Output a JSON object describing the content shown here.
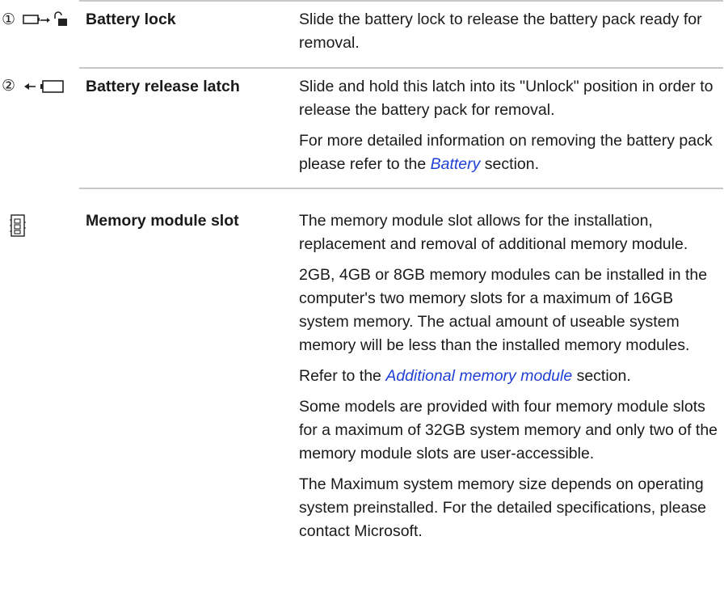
{
  "rows": [
    {
      "term": "Battery lock",
      "icon": "battery-lock-icon",
      "paragraphs": [
        {
          "text": "Slide the battery lock to release the battery pack ready for removal."
        }
      ]
    },
    {
      "term": "Battery release latch",
      "icon": "battery-release-latch-icon",
      "paragraphs": [
        {
          "text": "Slide and hold this latch into its \"Unlock\" position in order to release the battery pack for removal."
        },
        {
          "before": "For more detailed information on removing the battery pack please refer to the ",
          "link": "Battery",
          "after": " section."
        }
      ]
    },
    {
      "term": "Memory module slot",
      "icon": "memory-module-icon",
      "paragraphs": [
        {
          "text": "The memory module slot allows for the installation, replacement and removal of additional memory module."
        },
        {
          "text": "2GB, 4GB or 8GB memory modules can be installed in the computer's two memory slots for a maximum of 16GB system memory. The actual amount of useable system memory will be less than the installed memory modules."
        },
        {
          "before": "Refer to the ",
          "link": "Additional memory module",
          "after": " section."
        },
        {
          "text": "Some models are provided with four memory module slots for a maximum of 32GB system memory and only two of the memory module slots are user-accessible."
        },
        {
          "text": "The Maximum system memory size depends on operating system preinstalled. For the detailed specifications, please contact Microsoft."
        }
      ]
    }
  ],
  "icon_markers": {
    "battery_lock_number": "①",
    "battery_release_number": "②"
  },
  "colors": {
    "link": "#1f3fd6",
    "rule": "#c7c7c7",
    "text": "#1a1a1a"
  }
}
